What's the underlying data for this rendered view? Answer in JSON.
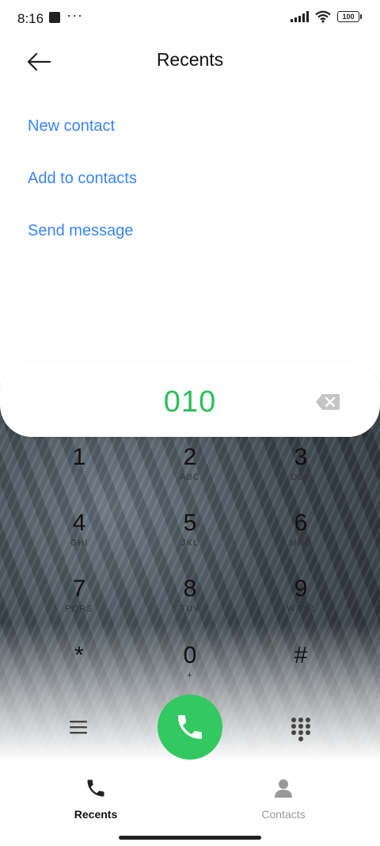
{
  "status_bar": {
    "time": "8:16",
    "dots": "···",
    "battery": "100"
  },
  "header": {
    "title": "Recents",
    "back_icon": "back-arrow-icon"
  },
  "actions": {
    "new_contact": "New contact",
    "add_to_contacts": "Add to contacts",
    "send_message": "Send message"
  },
  "dialer": {
    "number": "010",
    "number_color": "#2ebd5a"
  },
  "keypad": [
    {
      "digit": "1",
      "letters": ""
    },
    {
      "digit": "2",
      "letters": "ABC"
    },
    {
      "digit": "3",
      "letters": "DEF"
    },
    {
      "digit": "4",
      "letters": "GHI"
    },
    {
      "digit": "5",
      "letters": "JKL"
    },
    {
      "digit": "6",
      "letters": "MNO"
    },
    {
      "digit": "7",
      "letters": "PQRS"
    },
    {
      "digit": "8",
      "letters": "TUV"
    },
    {
      "digit": "9",
      "letters": "WXYZ"
    },
    {
      "digit": "*",
      "letters": ""
    },
    {
      "digit": "0",
      "letters": "+"
    },
    {
      "digit": "#",
      "letters": ""
    }
  ],
  "call_button_color": "#33c862",
  "accent_color": "#3a86f0",
  "nav": {
    "recents": "Recents",
    "contacts": "Contacts"
  }
}
